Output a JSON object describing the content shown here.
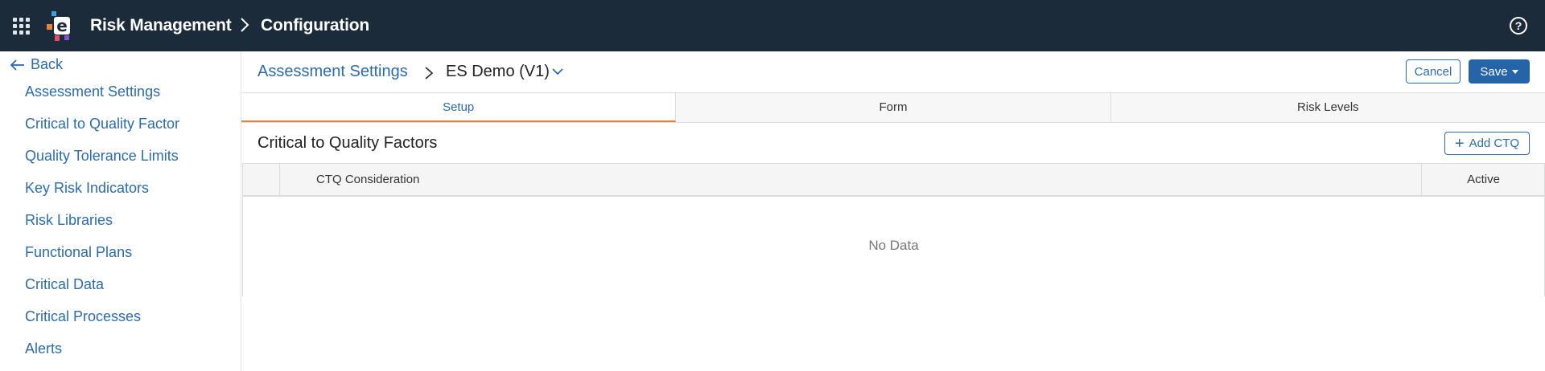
{
  "topbar": {
    "app_title": "Risk Management",
    "breadcrumb": "Configuration",
    "help_glyph": "?"
  },
  "sidebar": {
    "back_label": "Back",
    "items": [
      {
        "label": "Assessment Settings"
      },
      {
        "label": "Critical to Quality Factor"
      },
      {
        "label": "Quality Tolerance Limits"
      },
      {
        "label": "Key Risk Indicators"
      },
      {
        "label": "Risk Libraries"
      },
      {
        "label": "Functional Plans"
      },
      {
        "label": "Critical Data"
      },
      {
        "label": "Critical Processes"
      },
      {
        "label": "Alerts"
      }
    ]
  },
  "header": {
    "breadcrumb": "Assessment Settings",
    "version": "ES Demo (V1)",
    "cancel_label": "Cancel",
    "save_label": "Save"
  },
  "tabs": [
    {
      "label": "Setup",
      "active": true
    },
    {
      "label": "Form",
      "active": false
    },
    {
      "label": "Risk Levels",
      "active": false
    }
  ],
  "section": {
    "title": "Critical to Quality Factors",
    "add_label": "Add CTQ"
  },
  "table": {
    "columns": [
      "CTQ Consideration",
      "Active"
    ],
    "empty_text": "No Data"
  },
  "colors": {
    "topbar_bg": "#1b2b3a",
    "link_blue": "#2b6cb0",
    "primary_button": "#2564a8",
    "active_tab_underline": "#e8833a"
  }
}
